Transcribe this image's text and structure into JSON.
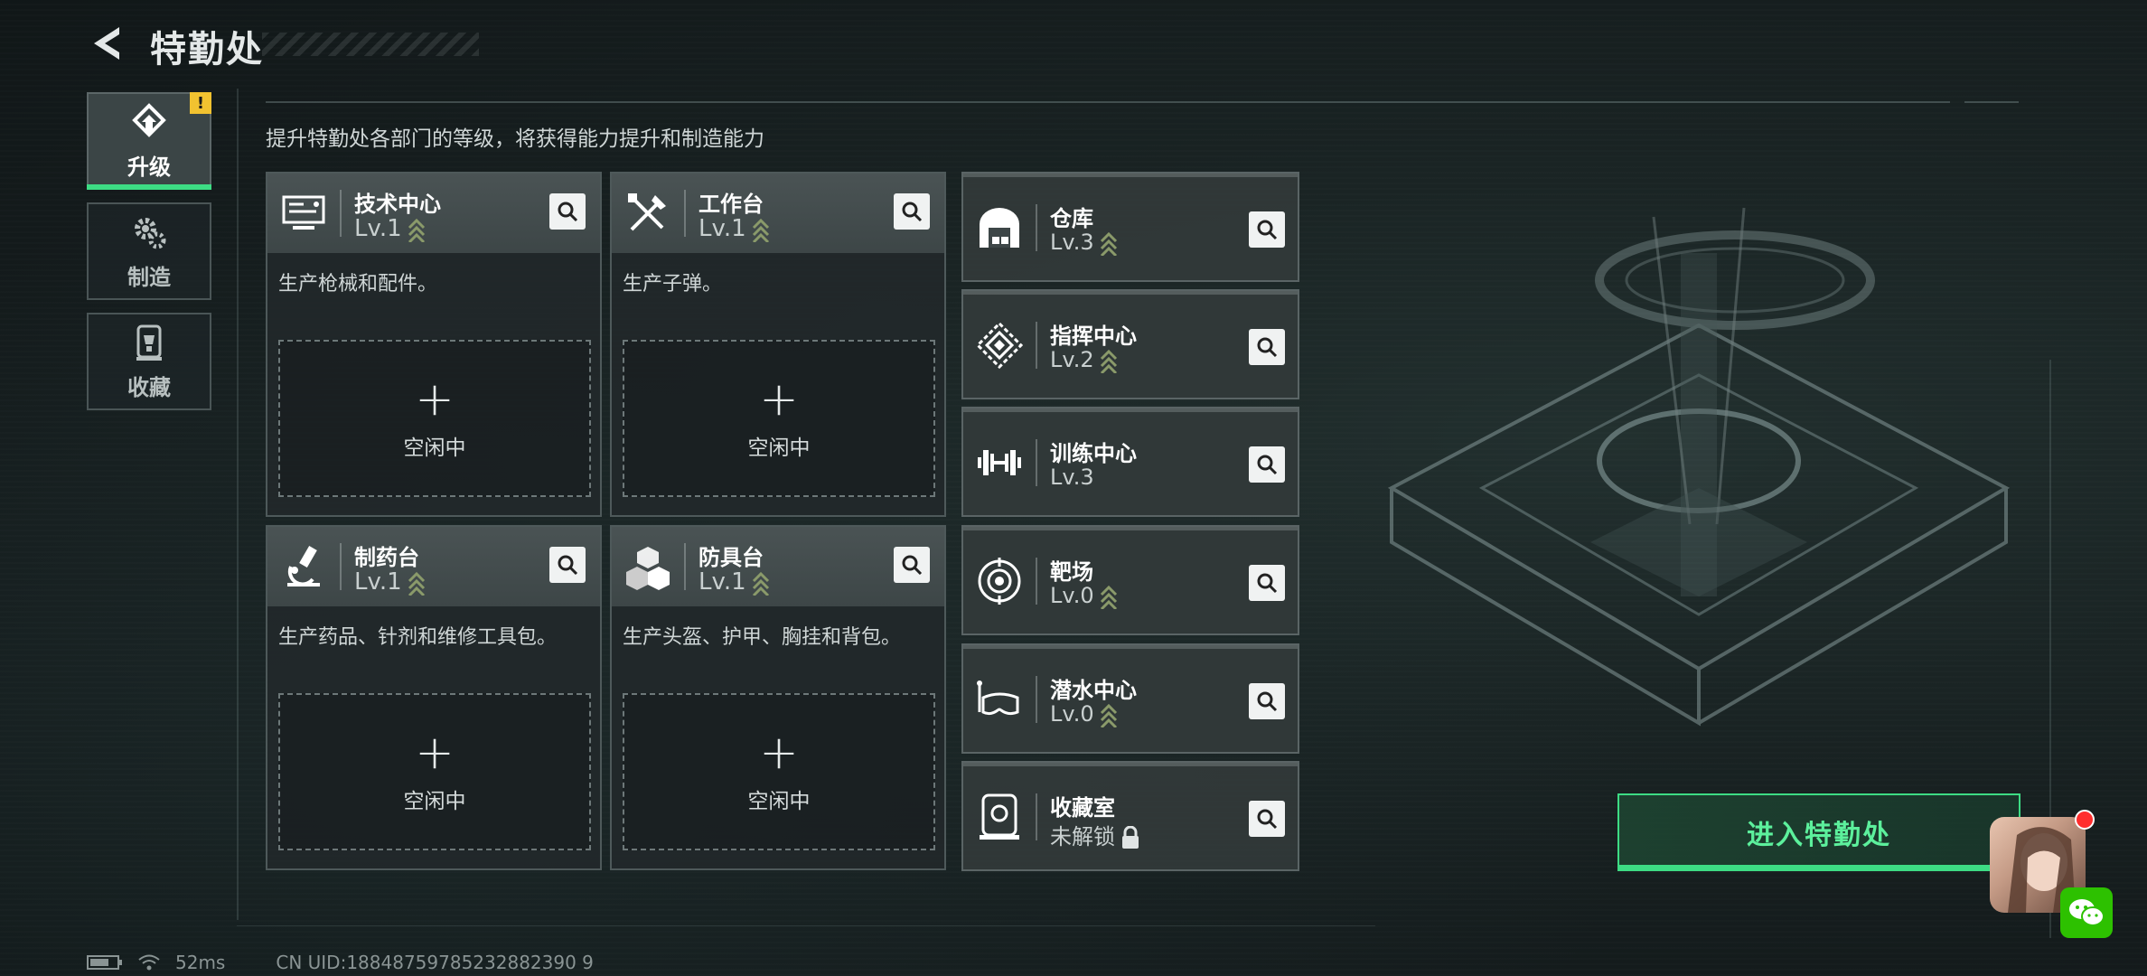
{
  "header": {
    "title": "特勤处"
  },
  "sidebar": {
    "tabs": [
      {
        "label": "升级",
        "icon": "upgrade-icon",
        "active": true,
        "badge": "!"
      },
      {
        "label": "制造",
        "icon": "gear-icon",
        "active": false
      },
      {
        "label": "收藏",
        "icon": "trophy-icon",
        "active": false
      }
    ]
  },
  "main": {
    "subtitle": "提升特勤处各部门的等级，将获得能力提升和制造能力",
    "production_cards": [
      {
        "name": "技术中心",
        "level": "Lv.1",
        "icon": "computer-icon",
        "desc": "生产枪械和配件。",
        "slot": {
          "plus": "+",
          "label": "空闲中"
        }
      },
      {
        "name": "工作台",
        "level": "Lv.1",
        "icon": "tools-icon",
        "desc": "生产子弹。",
        "slot": {
          "plus": "+",
          "label": "空闲中"
        }
      },
      {
        "name": "制药台",
        "level": "Lv.1",
        "icon": "microscope-icon",
        "desc": "生产药品、针剂和维修工具包。",
        "slot": {
          "plus": "+",
          "label": "空闲中"
        }
      },
      {
        "name": "防具台",
        "level": "Lv.1",
        "icon": "cubes-icon",
        "desc": "生产头盔、护甲、胸挂和背包。",
        "slot": {
          "plus": "+",
          "label": "空闲中"
        }
      }
    ],
    "facility_cards": [
      {
        "name": "仓库",
        "level": "Lv.3",
        "icon": "warehouse-icon",
        "upgradable": true
      },
      {
        "name": "指挥中心",
        "level": "Lv.2",
        "icon": "command-icon",
        "upgradable": true
      },
      {
        "name": "训练中心",
        "level": "Lv.3",
        "icon": "dumbbell-icon",
        "upgradable": false
      },
      {
        "name": "靶场",
        "level": "Lv.0",
        "icon": "target-icon",
        "upgradable": true
      },
      {
        "name": "潜水中心",
        "level": "Lv.0",
        "icon": "diving-mask-icon",
        "upgradable": true
      },
      {
        "name": "收藏室",
        "level": "未解锁",
        "icon": "collection-room-icon",
        "locked": true
      }
    ]
  },
  "enter_button": {
    "label": "进入特勤处"
  },
  "status": {
    "ping": "52ms",
    "uid": "CN UID:18848759785232882390 9"
  },
  "colors": {
    "accent": "#3ddc84",
    "warning": "#f2c230",
    "chevron": "#8a9a6a"
  }
}
